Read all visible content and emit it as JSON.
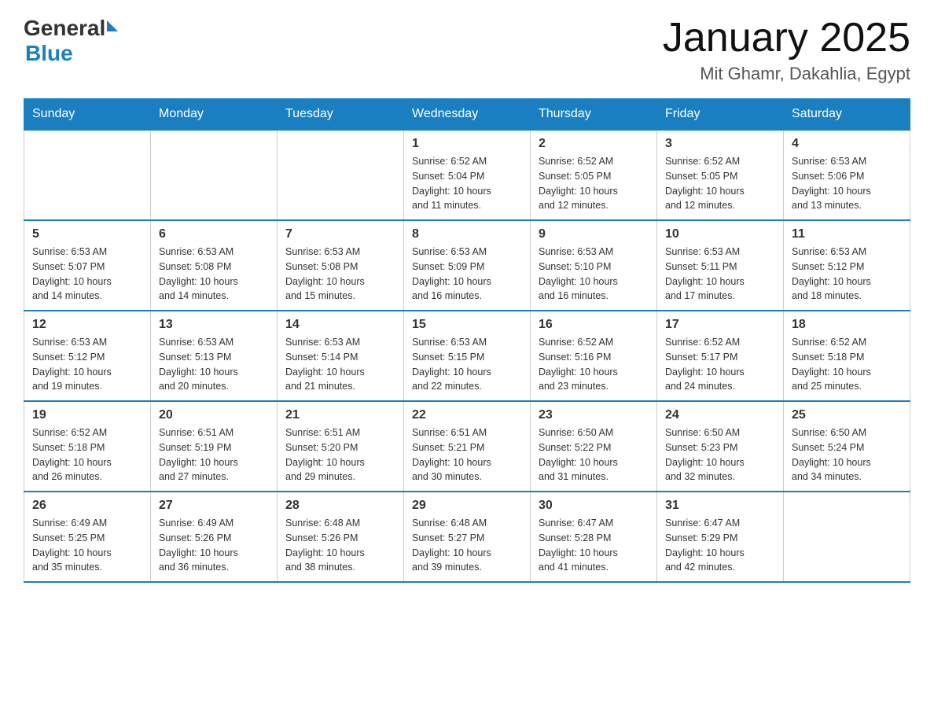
{
  "logo": {
    "general": "General",
    "arrow": "▶",
    "blue": "Blue"
  },
  "title": "January 2025",
  "subtitle": "Mit Ghamr, Dakahlia, Egypt",
  "days_of_week": [
    "Sunday",
    "Monday",
    "Tuesday",
    "Wednesday",
    "Thursday",
    "Friday",
    "Saturday"
  ],
  "weeks": [
    [
      {
        "day": "",
        "info": ""
      },
      {
        "day": "",
        "info": ""
      },
      {
        "day": "",
        "info": ""
      },
      {
        "day": "1",
        "info": "Sunrise: 6:52 AM\nSunset: 5:04 PM\nDaylight: 10 hours\nand 11 minutes."
      },
      {
        "day": "2",
        "info": "Sunrise: 6:52 AM\nSunset: 5:05 PM\nDaylight: 10 hours\nand 12 minutes."
      },
      {
        "day": "3",
        "info": "Sunrise: 6:52 AM\nSunset: 5:05 PM\nDaylight: 10 hours\nand 12 minutes."
      },
      {
        "day": "4",
        "info": "Sunrise: 6:53 AM\nSunset: 5:06 PM\nDaylight: 10 hours\nand 13 minutes."
      }
    ],
    [
      {
        "day": "5",
        "info": "Sunrise: 6:53 AM\nSunset: 5:07 PM\nDaylight: 10 hours\nand 14 minutes."
      },
      {
        "day": "6",
        "info": "Sunrise: 6:53 AM\nSunset: 5:08 PM\nDaylight: 10 hours\nand 14 minutes."
      },
      {
        "day": "7",
        "info": "Sunrise: 6:53 AM\nSunset: 5:08 PM\nDaylight: 10 hours\nand 15 minutes."
      },
      {
        "day": "8",
        "info": "Sunrise: 6:53 AM\nSunset: 5:09 PM\nDaylight: 10 hours\nand 16 minutes."
      },
      {
        "day": "9",
        "info": "Sunrise: 6:53 AM\nSunset: 5:10 PM\nDaylight: 10 hours\nand 16 minutes."
      },
      {
        "day": "10",
        "info": "Sunrise: 6:53 AM\nSunset: 5:11 PM\nDaylight: 10 hours\nand 17 minutes."
      },
      {
        "day": "11",
        "info": "Sunrise: 6:53 AM\nSunset: 5:12 PM\nDaylight: 10 hours\nand 18 minutes."
      }
    ],
    [
      {
        "day": "12",
        "info": "Sunrise: 6:53 AM\nSunset: 5:12 PM\nDaylight: 10 hours\nand 19 minutes."
      },
      {
        "day": "13",
        "info": "Sunrise: 6:53 AM\nSunset: 5:13 PM\nDaylight: 10 hours\nand 20 minutes."
      },
      {
        "day": "14",
        "info": "Sunrise: 6:53 AM\nSunset: 5:14 PM\nDaylight: 10 hours\nand 21 minutes."
      },
      {
        "day": "15",
        "info": "Sunrise: 6:53 AM\nSunset: 5:15 PM\nDaylight: 10 hours\nand 22 minutes."
      },
      {
        "day": "16",
        "info": "Sunrise: 6:52 AM\nSunset: 5:16 PM\nDaylight: 10 hours\nand 23 minutes."
      },
      {
        "day": "17",
        "info": "Sunrise: 6:52 AM\nSunset: 5:17 PM\nDaylight: 10 hours\nand 24 minutes."
      },
      {
        "day": "18",
        "info": "Sunrise: 6:52 AM\nSunset: 5:18 PM\nDaylight: 10 hours\nand 25 minutes."
      }
    ],
    [
      {
        "day": "19",
        "info": "Sunrise: 6:52 AM\nSunset: 5:18 PM\nDaylight: 10 hours\nand 26 minutes."
      },
      {
        "day": "20",
        "info": "Sunrise: 6:51 AM\nSunset: 5:19 PM\nDaylight: 10 hours\nand 27 minutes."
      },
      {
        "day": "21",
        "info": "Sunrise: 6:51 AM\nSunset: 5:20 PM\nDaylight: 10 hours\nand 29 minutes."
      },
      {
        "day": "22",
        "info": "Sunrise: 6:51 AM\nSunset: 5:21 PM\nDaylight: 10 hours\nand 30 minutes."
      },
      {
        "day": "23",
        "info": "Sunrise: 6:50 AM\nSunset: 5:22 PM\nDaylight: 10 hours\nand 31 minutes."
      },
      {
        "day": "24",
        "info": "Sunrise: 6:50 AM\nSunset: 5:23 PM\nDaylight: 10 hours\nand 32 minutes."
      },
      {
        "day": "25",
        "info": "Sunrise: 6:50 AM\nSunset: 5:24 PM\nDaylight: 10 hours\nand 34 minutes."
      }
    ],
    [
      {
        "day": "26",
        "info": "Sunrise: 6:49 AM\nSunset: 5:25 PM\nDaylight: 10 hours\nand 35 minutes."
      },
      {
        "day": "27",
        "info": "Sunrise: 6:49 AM\nSunset: 5:26 PM\nDaylight: 10 hours\nand 36 minutes."
      },
      {
        "day": "28",
        "info": "Sunrise: 6:48 AM\nSunset: 5:26 PM\nDaylight: 10 hours\nand 38 minutes."
      },
      {
        "day": "29",
        "info": "Sunrise: 6:48 AM\nSunset: 5:27 PM\nDaylight: 10 hours\nand 39 minutes."
      },
      {
        "day": "30",
        "info": "Sunrise: 6:47 AM\nSunset: 5:28 PM\nDaylight: 10 hours\nand 41 minutes."
      },
      {
        "day": "31",
        "info": "Sunrise: 6:47 AM\nSunset: 5:29 PM\nDaylight: 10 hours\nand 42 minutes."
      },
      {
        "day": "",
        "info": ""
      }
    ]
  ]
}
